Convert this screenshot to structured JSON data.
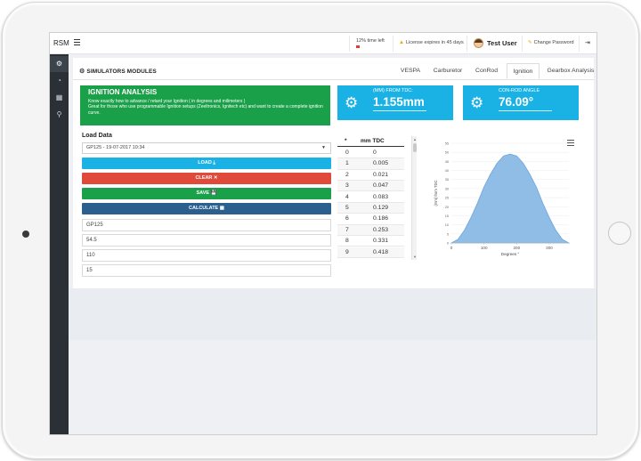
{
  "topbar": {
    "brand": "RSM",
    "time_left": "12% time left",
    "license": "License expires in 45 days",
    "user": "Test User",
    "change_password": "Change Password"
  },
  "sidebar": {
    "items": [
      {
        "icon": "cogs-icon"
      },
      {
        "icon": "dashboard-icon"
      },
      {
        "icon": "calculator-icon"
      },
      {
        "icon": "motorbike-icon"
      }
    ]
  },
  "panel": {
    "title": "SIMULATORS MODULES",
    "tabs": [
      {
        "label": "VESPA"
      },
      {
        "label": "Carburetor"
      },
      {
        "label": "ConRod"
      },
      {
        "label": "Ignition",
        "active": true
      },
      {
        "label": "Gearbox Analysis"
      }
    ]
  },
  "ignition": {
    "heading": "IGNITION ANALYSIS",
    "desc1": "Know exactly how to advance / retard your Ignition ( in degrees and milimeters )",
    "desc2": "Great for those who use programmable Ignition setups (Zeeltronics, Ignitech etc) and want to create a complete ignition curve."
  },
  "metrics": {
    "tdc_label": "(MM) FROM TDC:",
    "tdc_value": "1.155mm",
    "angle_label": "CON-ROD ANGLE",
    "angle_value": "76.09°"
  },
  "load": {
    "label": "Load Data",
    "selected": "GP125 - 19-07-2017 10:34",
    "load_btn": "LOAD ⤓",
    "clear_btn": "CLEAR ✕",
    "save_btn": "SAVE 💾",
    "calc_btn": "CALCULATE ▦",
    "fields": [
      "GP125",
      "54.5",
      "110",
      "15"
    ]
  },
  "table": {
    "col1": "*",
    "col2": "mm TDC",
    "rows": [
      [
        "0",
        "0"
      ],
      [
        "1",
        "0.005"
      ],
      [
        "2",
        "0.021"
      ],
      [
        "3",
        "0.047"
      ],
      [
        "4",
        "0.083"
      ],
      [
        "5",
        "0.129"
      ],
      [
        "6",
        "0.186"
      ],
      [
        "7",
        "0.253"
      ],
      [
        "8",
        "0.331"
      ],
      [
        "9",
        "0.418"
      ]
    ]
  },
  "chart_data": {
    "type": "area",
    "xlabel": "Degrees °",
    "ylabel": "(mm) from TDC",
    "x_ticks": [
      0,
      100,
      200,
      300
    ],
    "xlim": [
      0,
      360
    ],
    "y_ticks": [
      0,
      5,
      10,
      15,
      20,
      25,
      30,
      35,
      40,
      45,
      50,
      55
    ],
    "ylim": [
      0,
      55
    ],
    "x": [
      0,
      20,
      40,
      60,
      80,
      100,
      120,
      140,
      160,
      180,
      200,
      220,
      240,
      260,
      280,
      300,
      320,
      340,
      360
    ],
    "y": [
      0,
      2,
      7,
      14,
      22,
      31,
      38,
      44,
      48,
      49,
      48,
      44,
      38,
      31,
      22,
      14,
      7,
      2,
      0
    ],
    "color": "#90bde6"
  }
}
